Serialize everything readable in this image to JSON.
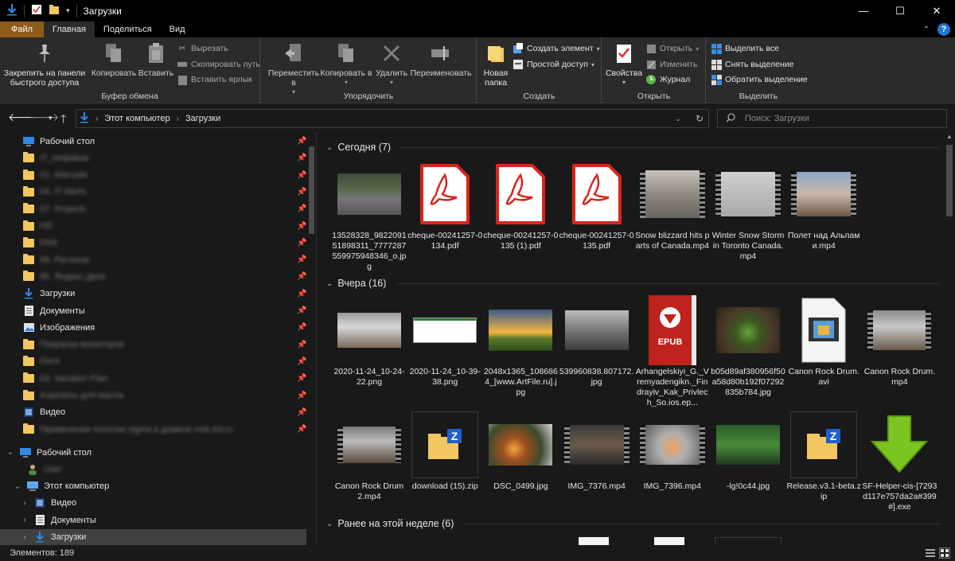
{
  "window": {
    "title": "Загрузки",
    "minimize": "—",
    "maximize": "☐",
    "close": "✕"
  },
  "ribbon_tabs": [
    "Файл",
    "Главная",
    "Поделиться",
    "Вид"
  ],
  "ribbon": {
    "clipboard": {
      "label": "Буфер обмена",
      "pin": "Закрепить на панели быстрого доступа",
      "copy": "Копировать",
      "paste": "Вставить",
      "cut": "Вырезать",
      "copy_path": "Скопировать путь",
      "paste_shortcut": "Вставить ярлык"
    },
    "organize": {
      "label": "Упорядочить",
      "move_to": "Переместить в",
      "copy_to": "Копировать в",
      "delete": "Удалить",
      "rename": "Переименовать"
    },
    "new": {
      "label": "Создать",
      "new_folder": "Новая папка",
      "new_item": "Создать элемент",
      "easy_access": "Простой доступ"
    },
    "open": {
      "label": "Открыть",
      "properties": "Свойства",
      "open": "Открыть",
      "edit": "Изменить",
      "history": "Журнал"
    },
    "select": {
      "label": "Выделить",
      "select_all": "Выделить все",
      "select_none": "Снять выделение",
      "invert": "Обратить выделение"
    }
  },
  "address": {
    "root": "Этот компьютер",
    "current": "Загрузки"
  },
  "search": {
    "placeholder": "Поиск: Загрузки"
  },
  "nav_quick": [
    {
      "label": "Рабочий стол",
      "icon": "desktop-icon",
      "blurred": false
    },
    {
      "label": "IT_Helpdesk",
      "icon": "folder-icon",
      "blurred": true
    },
    {
      "label": "01. Manuals",
      "icon": "folder-icon",
      "blurred": true
    },
    {
      "label": "04. IT Alerts",
      "icon": "folder-icon",
      "blurred": true
    },
    {
      "label": "07. Projects",
      "icon": "folder-icon",
      "blurred": true
    },
    {
      "label": "HD",
      "icon": "folder-icon",
      "blurred": true
    },
    {
      "label": "Distr",
      "icon": "folder-icon",
      "blurred": true
    },
    {
      "label": "99. Personal",
      "icon": "folder-icon",
      "blurred": true
    },
    {
      "label": "95. Яндекс.Диск",
      "icon": "folder-icon",
      "blurred": true
    },
    {
      "label": "Загрузки",
      "icon": "download-icon",
      "blurred": false
    },
    {
      "label": "Документы",
      "icon": "documents-icon",
      "blurred": false
    },
    {
      "label": "Изображения",
      "icon": "pictures-icon",
      "blurred": false
    },
    {
      "label": "Покраска мониторов",
      "icon": "folder-icon",
      "blurred": true
    },
    {
      "label": "Docs",
      "icon": "folder-icon",
      "blurred": true
    },
    {
      "label": "03. Vacation Plan",
      "icon": "folder-icon",
      "blurred": true
    },
    {
      "label": "Аэрозоль для масла",
      "icon": "folder-icon",
      "blurred": true
    },
    {
      "label": "Видео",
      "icon": "video-icon",
      "blurred": false
    },
    {
      "label": "Применение политик sigma в домене msk.trd.ru",
      "icon": "folder-icon",
      "blurred": true
    }
  ],
  "nav_tree": [
    {
      "label": "Рабочий стол",
      "icon": "desktop-icon",
      "expand": "⌄",
      "indent": 0
    },
    {
      "label": "User",
      "icon": "user-icon",
      "expand": "",
      "indent": 1,
      "blurred": true
    },
    {
      "label": "Этот компьютер",
      "icon": "computer-icon",
      "expand": "⌄",
      "indent": 1
    },
    {
      "label": "Видео",
      "icon": "video-icon",
      "expand": "›",
      "indent": 2
    },
    {
      "label": "Документы",
      "icon": "documents-icon",
      "expand": "›",
      "indent": 2
    },
    {
      "label": "Загрузки",
      "icon": "download-icon",
      "expand": "›",
      "indent": 2,
      "selected": true
    }
  ],
  "groups": [
    {
      "title": "Сегодня (7)",
      "files": [
        {
          "name": "13528328_982209151898311_7777287559975948346_o.jpg",
          "kind": "photo-moto"
        },
        {
          "name": "cheque-00241257-0134.pdf",
          "kind": "pdf"
        },
        {
          "name": "cheque-00241257-0135 (1).pdf",
          "kind": "pdf"
        },
        {
          "name": "cheque-00241257-0135.pdf",
          "kind": "pdf"
        },
        {
          "name": "Snow blizzard hits parts of Canada.mp4",
          "kind": "video-snow"
        },
        {
          "name": "Winter Snow Storm in Toronto Canada.mp4",
          "kind": "video-storm"
        },
        {
          "name": "Полет над Альпами.mp4",
          "kind": "video-alps"
        }
      ]
    },
    {
      "title": "Вчера (16)",
      "files": [
        {
          "name": "2020-11-24_10-24-22.png",
          "kind": "photo-drum"
        },
        {
          "name": "2020-11-24_10-39-38.png",
          "kind": "screenshot"
        },
        {
          "name": "2048x1365_1086864_[www.ArtFile.ru].jpg",
          "kind": "photo-sunset"
        },
        {
          "name": "539960838.807172.jpg",
          "kind": "photo-bw"
        },
        {
          "name": "Arhangelskiyi_G._Vremyadengikn._Findrayiv_Kak_Privlech_So.ios.ep...",
          "kind": "epub"
        },
        {
          "name": "b05d89af380956f50a58d80b192f07292835b784.jpg",
          "kind": "photo-plant"
        },
        {
          "name": "Canon Rock Drum.avi",
          "kind": "avi"
        },
        {
          "name": "Canon Rock Drum.mp4",
          "kind": "video-drum"
        },
        {
          "name": "Canon Rock Drum2.mp4",
          "kind": "video-drum2"
        },
        {
          "name": "download (15).zip",
          "kind": "zip"
        },
        {
          "name": "DSC_0499.jpg",
          "kind": "photo-fire"
        },
        {
          "name": "IMG_7376.mp4",
          "kind": "video-pan"
        },
        {
          "name": "IMG_7396.mp4",
          "kind": "video-food"
        },
        {
          "name": "-lg!0c44.jpg",
          "kind": "photo-forest"
        },
        {
          "name": "Release.v3.1-beta.zip",
          "kind": "zip"
        },
        {
          "name": "SF-Helper-cis-[7293d117e757da2a#399#].exe",
          "kind": "exe"
        }
      ]
    },
    {
      "title": "Ранее на этой неделе (6)",
      "files": []
    }
  ],
  "status": {
    "items_label": "Элементов: 189"
  },
  "labels": {
    "pdf": "PDF",
    "epub": "EPUB"
  },
  "colors": {
    "file_tab": "#8d5b17",
    "folder": "#f2c660",
    "accent_blue": "#2f8ae6",
    "pdf_red": "#d9251d",
    "epub_red": "#c0221e",
    "exe_green": "#7cc420"
  }
}
